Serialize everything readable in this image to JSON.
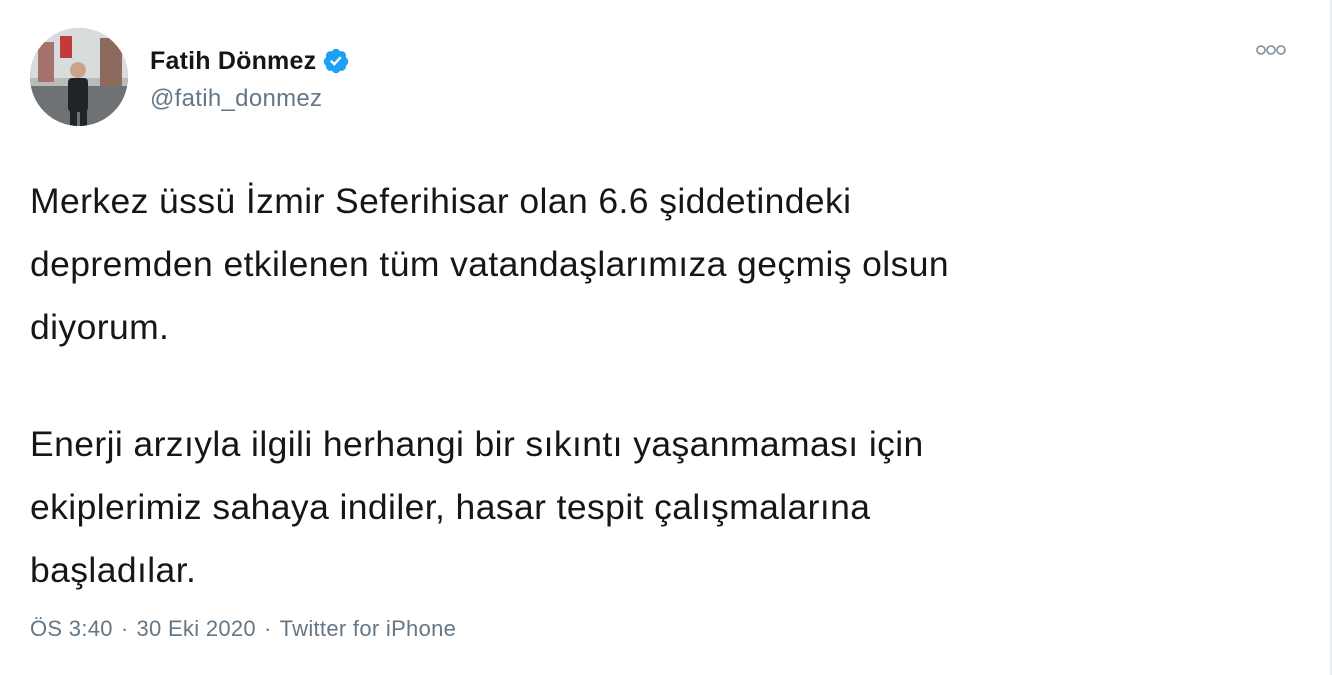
{
  "author": {
    "display_name": "Fatih Dönmez",
    "handle": "@fatih_donmez",
    "verified": true,
    "verified_color": "#1da1f2"
  },
  "tweet": {
    "paragraphs": [
      [
        "Merkez üssü İzmir Seferihisar olan 6.6 şiddetindeki",
        "depremden etkilenen tüm vatandaşlarımıza geçmiş olsun",
        "diyorum."
      ],
      [
        "Enerji arzıyla ilgili herhangi bir sıkıntı yaşanmaması için",
        "ekiplerimiz sahaya indiler, hasar tespit çalışmalarına",
        "başladılar."
      ]
    ]
  },
  "meta": {
    "time": "ÖS 3:40",
    "separator": "·",
    "date": "30 Eki 2020",
    "source": "Twitter for iPhone"
  },
  "icons": {
    "avatar": "profile-photo",
    "verified": "verified-badge-icon",
    "more": "more-options-icon"
  }
}
